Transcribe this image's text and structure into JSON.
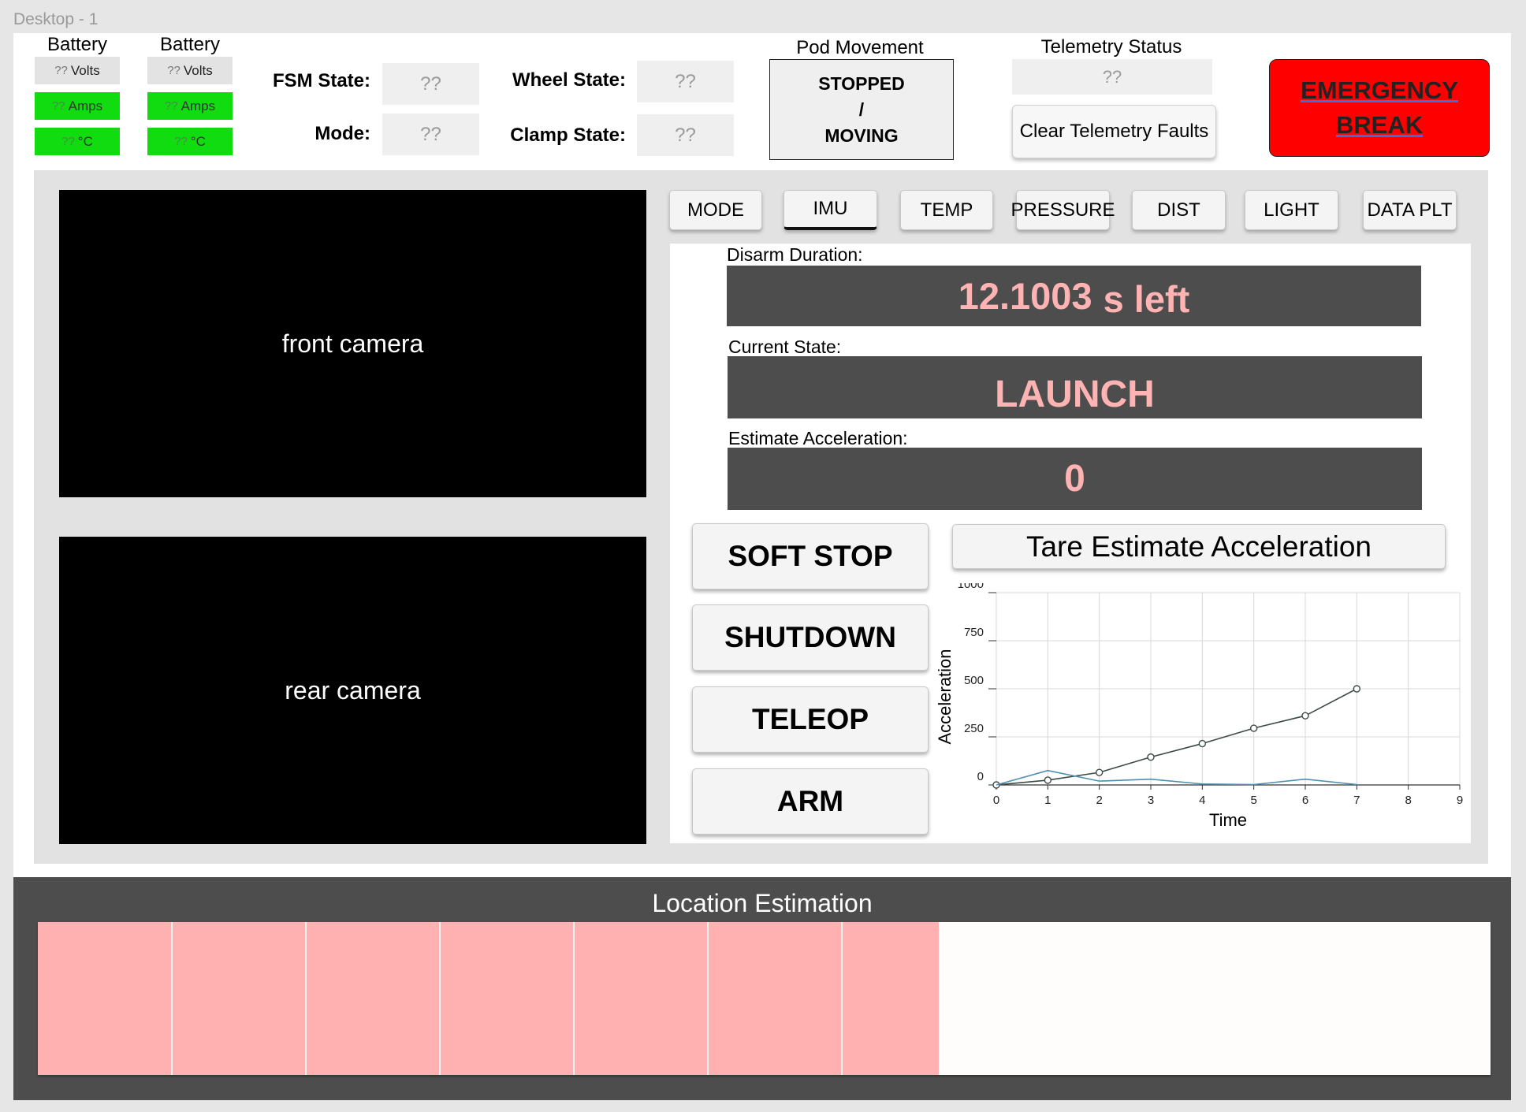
{
  "frame_label": "Desktop - 1",
  "batteries": [
    {
      "title": "Battery",
      "volts_q": "??",
      "volts_unit": "Volts",
      "amps_q": "??",
      "amps_unit": "Amps",
      "temp_q": "??",
      "temp_unit": "°C"
    },
    {
      "title": "Battery",
      "volts_q": "??",
      "volts_unit": "Volts",
      "amps_q": "??",
      "amps_unit": "Amps",
      "temp_q": "??",
      "temp_unit": "°C"
    }
  ],
  "states": {
    "fsm_label": "FSM State:",
    "fsm_value": "??",
    "mode_label": "Mode:",
    "mode_value": "??",
    "wheel_label": "Wheel State:",
    "wheel_value": "??",
    "clamp_label": "Clamp State:",
    "clamp_value": "??"
  },
  "pod_movement": {
    "title": "Pod Movement",
    "line1": "STOPPED",
    "line2": "/",
    "line3": "MOVING"
  },
  "telemetry": {
    "title": "Telemetry Status",
    "value": "??",
    "clear_label": "Clear Telemetry Faults"
  },
  "emergency": {
    "line1": "EMERGENCY",
    "line2": "BREAK",
    "color": "#ff0000"
  },
  "cameras": {
    "front": "front camera",
    "rear": "rear camera"
  },
  "tabs": [
    "MODE",
    "IMU",
    "TEMP",
    "PRESSURE",
    "DIST",
    "LIGHT",
    "DATA PLT"
  ],
  "active_tab": "IMU",
  "fields": {
    "disarm_label": "Disarm Duration:",
    "disarm_number": "12.1003",
    "disarm_suffix": "s left",
    "state_label": "Current State:",
    "state_value": "LAUNCH",
    "accel_label": "Estimate Acceleration:",
    "accel_value": "0"
  },
  "controls": {
    "soft_stop": "SOFT STOP",
    "shutdown": "SHUTDOWN",
    "teleop": "TELEOP",
    "arm": "ARM",
    "tare": "Tare Estimate Acceleration"
  },
  "chart_data": {
    "type": "line",
    "xlabel": "Time",
    "ylabel": "Acceleration",
    "xlim": [
      0,
      9
    ],
    "ylim": [
      0,
      1000
    ],
    "x_ticks": [
      "0",
      "1",
      "2",
      "3",
      "4",
      "5",
      "6",
      "7",
      "8",
      "9"
    ],
    "y_ticks": [
      "0",
      "250",
      "500",
      "750",
      "1000"
    ],
    "grid": true,
    "series": [
      {
        "x": [
          0,
          1,
          2,
          3,
          4,
          5,
          6,
          7
        ],
        "values": [
          0,
          25,
          65,
          145,
          215,
          295,
          360,
          500
        ],
        "color": "#3d4a46",
        "markers": true
      },
      {
        "x": [
          0,
          1,
          2,
          3,
          4,
          5,
          6,
          7
        ],
        "values": [
          0,
          75,
          20,
          30,
          5,
          2,
          30,
          2
        ],
        "color": "#4e8fb0",
        "markers": false
      }
    ]
  },
  "location": {
    "title": "Location Estimation",
    "progress_percent": 62,
    "segments": 7,
    "fill_color": "#ffb0b0"
  }
}
